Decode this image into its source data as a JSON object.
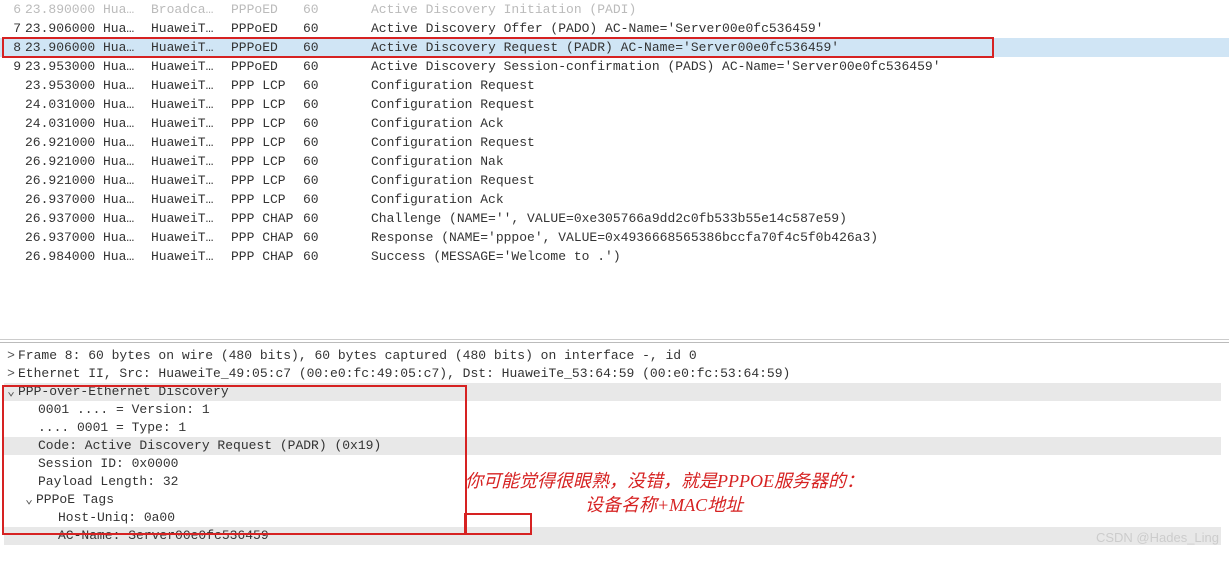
{
  "rows": [
    {
      "no": "6",
      "time": "23.890000",
      "src": "Hua…",
      "dst": "Broadca…",
      "proto": "PPPoED",
      "len": "60",
      "info": "Active Discovery Initiation (PADI)",
      "faded": true
    },
    {
      "no": "7",
      "time": "23.906000",
      "src": "Hua…",
      "dst": "HuaweiT…",
      "proto": "PPPoED",
      "len": "60",
      "info": "Active Discovery Offer (PADO) AC-Name='Server00e0fc536459'"
    },
    {
      "no": "8",
      "time": "23.906000",
      "src": "Hua…",
      "dst": "HuaweiT…",
      "proto": "PPPoED",
      "len": "60",
      "info": "Active Discovery Request (PADR) AC-Name='Server00e0fc536459'",
      "selected": true
    },
    {
      "no": "9",
      "time": "23.953000",
      "src": "Hua…",
      "dst": "HuaweiT…",
      "proto": "PPPoED",
      "len": "60",
      "info": "Active Discovery Session-confirmation (PADS) AC-Name='Server00e0fc536459'"
    },
    {
      "no": "",
      "time": "23.953000",
      "src": "Hua…",
      "dst": "HuaweiT…",
      "proto": "PPP LCP",
      "len": "60",
      "info": "Configuration Request"
    },
    {
      "no": "",
      "time": "24.031000",
      "src": "Hua…",
      "dst": "HuaweiT…",
      "proto": "PPP LCP",
      "len": "60",
      "info": "Configuration Request"
    },
    {
      "no": "",
      "time": "24.031000",
      "src": "Hua…",
      "dst": "HuaweiT…",
      "proto": "PPP LCP",
      "len": "60",
      "info": "Configuration Ack"
    },
    {
      "no": "",
      "time": "26.921000",
      "src": "Hua…",
      "dst": "HuaweiT…",
      "proto": "PPP LCP",
      "len": "60",
      "info": "Configuration Request"
    },
    {
      "no": "",
      "time": "26.921000",
      "src": "Hua…",
      "dst": "HuaweiT…",
      "proto": "PPP LCP",
      "len": "60",
      "info": "Configuration Nak"
    },
    {
      "no": "",
      "time": "26.921000",
      "src": "Hua…",
      "dst": "HuaweiT…",
      "proto": "PPP LCP",
      "len": "60",
      "info": "Configuration Request"
    },
    {
      "no": "",
      "time": "26.937000",
      "src": "Hua…",
      "dst": "HuaweiT…",
      "proto": "PPP LCP",
      "len": "60",
      "info": "Configuration Ack"
    },
    {
      "no": "",
      "time": "26.937000",
      "src": "Hua…",
      "dst": "HuaweiT…",
      "proto": "PPP CHAP",
      "len": "60",
      "info": "Challenge (NAME='', VALUE=0xe305766a9dd2c0fb533b55e14c587e59)"
    },
    {
      "no": "",
      "time": "26.937000",
      "src": "Hua…",
      "dst": "HuaweiT…",
      "proto": "PPP CHAP",
      "len": "60",
      "info": "Response (NAME='pppoe', VALUE=0x4936668565386bccfa70f4c5f0b426a3)"
    },
    {
      "no": "",
      "time": "26.984000",
      "src": "Hua…",
      "dst": "HuaweiT…",
      "proto": "PPP CHAP",
      "len": "60",
      "info": "Success (MESSAGE='Welcome to .')"
    }
  ],
  "detail": {
    "frame": "Frame 8: 60 bytes on wire (480 bits), 60 bytes captured (480 bits) on interface -, id 0",
    "eth": "Ethernet II, Src: HuaweiTe_49:05:c7 (00:e0:fc:49:05:c7), Dst: HuaweiTe_53:64:59 (00:e0:fc:53:64:59)",
    "pppoe": "PPP-over-Ethernet Discovery",
    "version": "0001 .... = Version: 1",
    "type": ".... 0001 = Type: 1",
    "code": "Code: Active Discovery Request (PADR) (0x19)",
    "session": "Session ID: 0x0000",
    "payload": "Payload Length: 32",
    "tags": "PPPoE Tags",
    "hostuniq": "Host-Uniq: 0a00",
    "acname": "AC-Name: Server00e0fc536459"
  },
  "annotation": {
    "line1": "你可能觉得很眼熟，没错，就是PPPOE服务器的：",
    "line2": "设备名称+MAC地址"
  },
  "watermark": "CSDN @Hades_Ling",
  "arrows": {
    "right": ">",
    "down": "⌄"
  }
}
